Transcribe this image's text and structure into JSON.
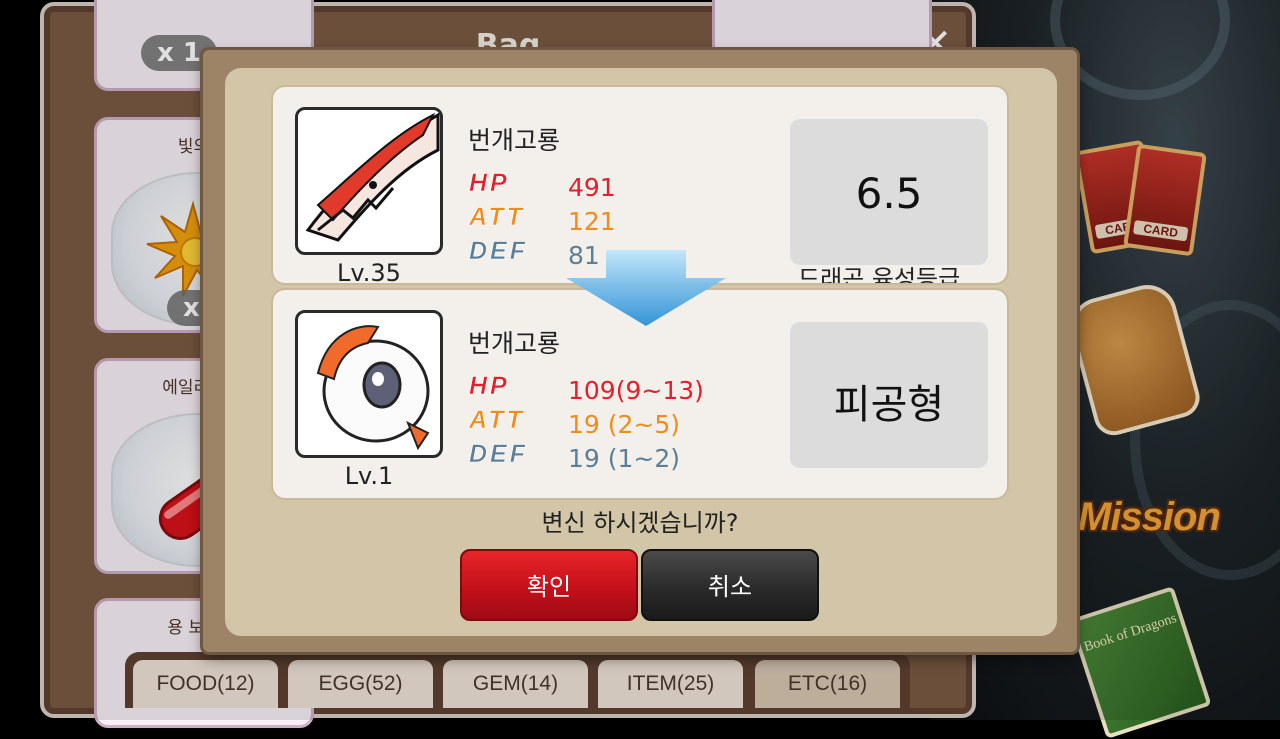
{
  "bag": {
    "title": "Bag",
    "items": [
      {
        "name": "",
        "count": "x 1"
      },
      {
        "name": "빛의 정",
        "count": "x"
      },
      {
        "name": "에일리언 변",
        "count": "x"
      },
      {
        "name": "용 보유 수",
        "count": ""
      }
    ],
    "tabs": [
      "FOOD(12)",
      "EGG(52)",
      "GEM(14)",
      "ITEM(25)",
      "ETC(16)"
    ]
  },
  "side": {
    "card_label": "CARD",
    "mission_label": "Mission",
    "book_label": "Book of Dragons"
  },
  "dialog": {
    "before": {
      "name": "번개고룡",
      "level": "Lv.35",
      "hp_label": "HP",
      "att_label": "ATT",
      "def_label": "DEF",
      "hp": "491",
      "att": "121",
      "def": "81",
      "grade_value": "6.5",
      "grade_label": "드래곤 육성등급"
    },
    "after": {
      "name": "번개고룡",
      "level": "Lv.1",
      "hp_label": "HP",
      "att_label": "ATT",
      "def_label": "DEF",
      "hp": "109(9~13)",
      "att": "19 (2~5)",
      "def": "19 (1~2)",
      "type_value": "피공형"
    },
    "question": "변신 하시겠습니까?",
    "confirm_label": "확인",
    "cancel_label": "취소"
  },
  "colors": {
    "hp": "#e0202b",
    "att": "#f08c1c",
    "def": "#5b7f98",
    "confirm": "#d0141e",
    "cancel": "#2b2b2b"
  }
}
